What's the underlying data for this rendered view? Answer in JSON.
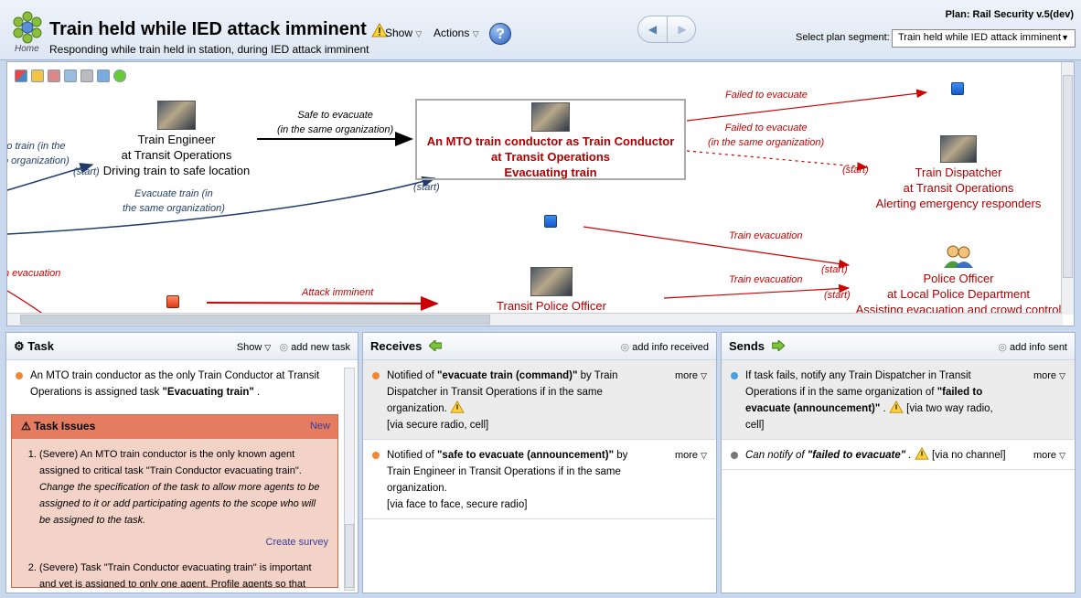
{
  "header": {
    "home_label": "Home",
    "title": "Train held while IED attack imminent",
    "subtitle": "Responding while train held in station, during IED attack imminent",
    "show_menu": "Show",
    "actions_menu": "Actions",
    "help_label": "?",
    "plan_label": "Plan: Rail Security v.5(dev)",
    "segment_label": "Select plan segment:",
    "segment_value": "Train held while IED attack imminent"
  },
  "map": {
    "nodes": {
      "engineer": [
        "Train Engineer",
        "at Transit Operations",
        "Driving train to safe location"
      ],
      "conductor": [
        "An MTO train conductor as Train Conductor",
        "at Transit Operations",
        "Evacuating train"
      ],
      "dispatcher": [
        "Train Dispatcher",
        "at Transit Operations",
        "Alerting emergency responders"
      ],
      "police": [
        "Police Officer",
        "at Local Police Department",
        "Assisting evacuation and crowd control"
      ],
      "transit_police": [
        "Transit Police Officer"
      ]
    },
    "edges": {
      "safe_evacuate": [
        "Safe to evacuate",
        "(in the same organization)"
      ],
      "failed_evacuate": "Failed to evacuate",
      "failed_evacuate_org": [
        "Failed to evacuate",
        "(in the same organization)"
      ],
      "evacuate_train": [
        "Evacuate train (in",
        "the same organization)"
      ],
      "to_train": [
        "o train (in the",
        "o organization)"
      ],
      "n_evacuation": "n evacuation",
      "train_evacuation_1": "Train evacuation",
      "train_evacuation_2": "Train evacuation",
      "attack_imminent": "Attack imminent",
      "start": "(start)"
    }
  },
  "task_panel": {
    "title": "Task",
    "show": "Show",
    "add": "add new task",
    "description_pre": "An MTO train conductor as the only Train Conductor at Transit Operations is assigned task ",
    "description_task": "\"Evacuating train\"",
    "description_post": " .",
    "issues_title": "Task Issues",
    "issues_new": "New",
    "issue1_text": "(Severe) An MTO train conductor is the only known agent assigned to critical task \"Train Conductor evacuating train\".",
    "issue1_remedy": "Change the specification of the task to allow more agents to be assigned to it or add participating agents to the scope who will be assigned to the task.",
    "create_survey": "Create survey",
    "issue2_text": "(Severe) Task \"Train Conductor evacuating train\" is important and yet is assigned to only one agent. Profile agents so that more"
  },
  "receives_panel": {
    "title": "Receives",
    "add": "add info received",
    "items": [
      {
        "pre": "Notified of ",
        "bold": "\"evacuate train (command)\"",
        "post": " by Train Dispatcher in Transit Operations if in the same organization.",
        "via": "[via secure radio, cell]",
        "more": "more"
      },
      {
        "pre": "Notified of ",
        "bold": "\"safe to evacuate (announcement)\"",
        "post": " by Train Engineer in Transit Operations if in the same organization.",
        "via": "[via face to face, secure radio]",
        "more": "more"
      }
    ]
  },
  "sends_panel": {
    "title": "Sends",
    "add": "add info sent",
    "items": [
      {
        "pre": "If task fails, notify any Train Dispatcher in Transit Operations if in the same organization of ",
        "bold": "\"failed to evacuate (announcement)\"",
        "post": " .",
        "via": "[via two way radio, cell]",
        "more": "more"
      },
      {
        "pre": "Can notify of ",
        "bold": "\"failed to evacuate\"",
        "post": " .",
        "via": "[via no channel]",
        "more": "more"
      }
    ]
  },
  "colors": {
    "accent_red": "#b20000",
    "issue_header": "#e57b5f",
    "issue_bg": "#f3d3c7",
    "item_blue_dot": "#4a9fe0",
    "item_orange_dot": "#f0883a"
  }
}
